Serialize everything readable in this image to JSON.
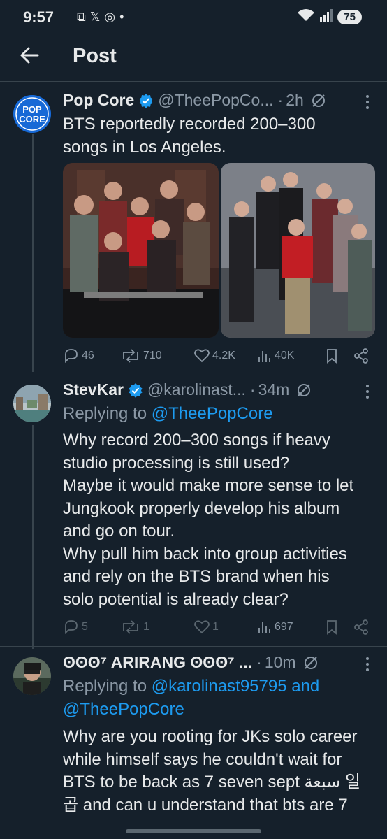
{
  "status_bar": {
    "time": "9:57",
    "battery": "75"
  },
  "header": {
    "title": "Post"
  },
  "tweets": [
    {
      "name": "Pop Core",
      "handle": "@TheePopCo...",
      "time": "2h",
      "avatar_text": [
        "POP",
        "CORE"
      ],
      "text": [
        "BTS reportedly recorded 200–300",
        "songs in Los Angeles."
      ],
      "stats": {
        "replies": "46",
        "reposts": "710",
        "likes": "4.2K",
        "views": "40K"
      }
    },
    {
      "name": "StevKar",
      "handle": "@karolinast...",
      "time": "34m",
      "replying_label": "Replying to",
      "replying_to": "@TheePopCore",
      "text": [
        "Why record 200–300 songs if heavy",
        "studio processing is still used?",
        "Maybe it would make more sense to let",
        "Jungkook properly develop his album",
        "and go on tour.",
        "Why pull him back into group activities",
        "and rely on the BTS brand when his",
        "solo potential is already clear?"
      ],
      "stats": {
        "replies": "5",
        "reposts": "1",
        "likes": "1",
        "views": "697"
      }
    },
    {
      "name": "ʘʘʘ⁷ ARIRANG ʘʘʘ⁷ ...",
      "time": "10m",
      "replying_label": "Replying to",
      "replying_to_line1": "@karolinast95795 and",
      "replying_to_line2": "@TheePopCore",
      "text": [
        "Why are you rooting for JKs solo career",
        "while himself says he couldn't wait for",
        "BTS to be back as 7 seven sept  سبعة 일",
        "곱 and can u understand that bts are 7"
      ]
    }
  ],
  "colors": {
    "background": "#15202b",
    "accent": "#1d9bf0",
    "muted": "#8b98a5"
  }
}
